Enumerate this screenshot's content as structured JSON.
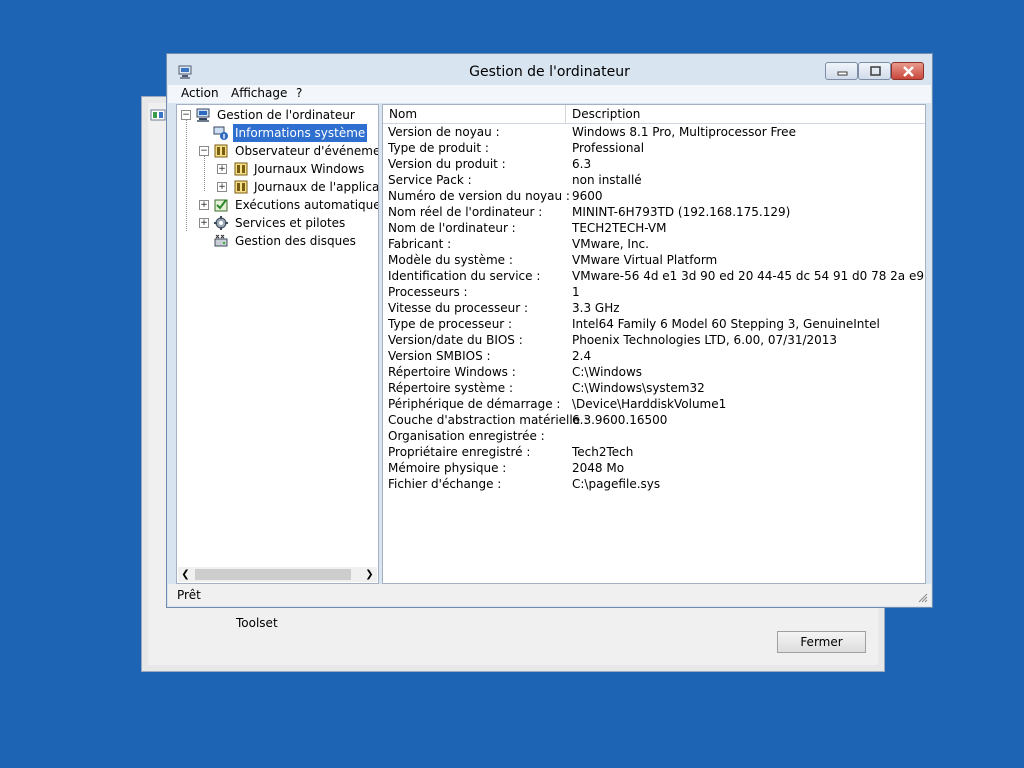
{
  "background_window": {
    "toolset_text": "Toolset",
    "close_button": "Fermer"
  },
  "window": {
    "title": "Gestion de l'ordinateur",
    "menu": [
      "Action",
      "Affichage",
      "?"
    ],
    "status": "Prêt"
  },
  "tree": {
    "root": "Gestion de l'ordinateur",
    "items": [
      "Informations système",
      "Observateur d'événements",
      "Journaux Windows",
      "Journaux de l'applicatio",
      "Exécutions automatiques",
      "Services et pilotes",
      "Gestion des disques"
    ]
  },
  "list": {
    "columns": [
      "Nom",
      "Description"
    ],
    "rows": [
      [
        "Version de noyau :",
        "Windows 8.1 Pro, Multiprocessor Free"
      ],
      [
        "Type de produit :",
        "Professional"
      ],
      [
        "Version du produit :",
        "6.3"
      ],
      [
        "Service Pack :",
        "non installé"
      ],
      [
        "Numéro de version du noyau :",
        "9600"
      ],
      [
        "Nom réel de l'ordinateur :",
        "MININT-6H793TD (192.168.175.129)"
      ],
      [
        "Nom de l'ordinateur :",
        "TECH2TECH-VM"
      ],
      [
        "Fabricant :",
        "VMware, Inc."
      ],
      [
        "Modèle du système :",
        "VMware Virtual Platform"
      ],
      [
        "Identification du service :",
        "VMware-56 4d e1 3d 90 ed 20 44-45 dc 54 91 d0 78 2a e9"
      ],
      [
        "Processeurs :",
        "1"
      ],
      [
        "Vitesse du processeur :",
        "3.3 GHz"
      ],
      [
        "Type de processeur :",
        "Intel64 Family 6 Model 60 Stepping 3, GenuineIntel"
      ],
      [
        "Version/date du BIOS :",
        "Phoenix Technologies LTD, 6.00, 07/31/2013"
      ],
      [
        "Version SMBIOS :",
        "2.4"
      ],
      [
        "Répertoire Windows :",
        "C:\\Windows"
      ],
      [
        "Répertoire système :",
        "C:\\Windows\\system32"
      ],
      [
        "Périphérique de démarrage :",
        "\\Device\\HarddiskVolume1"
      ],
      [
        "Couche d'abstraction matérielle :",
        "6.3.9600.16500"
      ],
      [
        "Organisation enregistrée :",
        ""
      ],
      [
        "Propriétaire enregistré :",
        "Tech2Tech"
      ],
      [
        "Mémoire physique :",
        "2048 Mo"
      ],
      [
        "Fichier d'échange :",
        "C:\\pagefile.sys"
      ]
    ]
  }
}
